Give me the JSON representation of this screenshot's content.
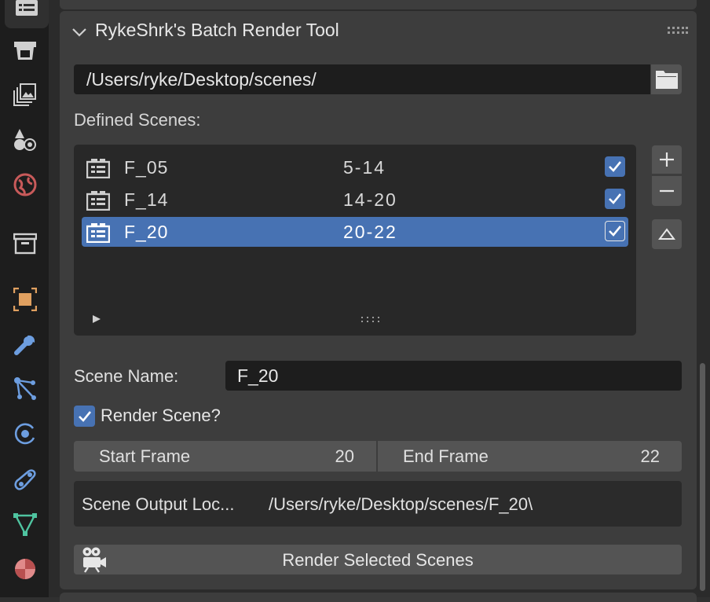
{
  "panel": {
    "title": "RykeShrk's Batch Render Tool",
    "directory_path": "/Users/ryke/Desktop/scenes/",
    "defined_scenes_label": "Defined Scenes:"
  },
  "scenes": [
    {
      "name": "F_05",
      "range": "5-14",
      "enabled": true,
      "selected": false
    },
    {
      "name": "F_14",
      "range": "14-20",
      "enabled": true,
      "selected": false
    },
    {
      "name": "F_20",
      "range": "20-22",
      "enabled": true,
      "selected": true
    }
  ],
  "list_buttons": {
    "add": "+",
    "remove": "−",
    "move_up": "△"
  },
  "active_scene": {
    "name_label": "Scene Name:",
    "name_value": "F_20",
    "render_label": "Render Scene?",
    "render_checked": true,
    "start_label": "Start Frame",
    "start_value": "20",
    "end_label": "End Frame",
    "end_value": "22",
    "output_label": "Scene Output Loc...",
    "output_value": "/Users/ryke/Desktop/scenes/F_20\\"
  },
  "render_button": {
    "label": "Render Selected Scenes",
    "icon": "camera-icon"
  },
  "sidebar_tabs": [
    "render-icon",
    "output-icon",
    "view-layer-icon",
    "scene-icon",
    "world-icon",
    "collection-icon",
    "object-icon",
    "modifier-icon",
    "particles-icon",
    "physics-icon",
    "constraints-icon",
    "data-icon",
    "material-icon"
  ],
  "colors": {
    "accent": "#4772b3",
    "panel": "#3d3d3d",
    "field": "#1d1d1d",
    "button": "#545454"
  }
}
